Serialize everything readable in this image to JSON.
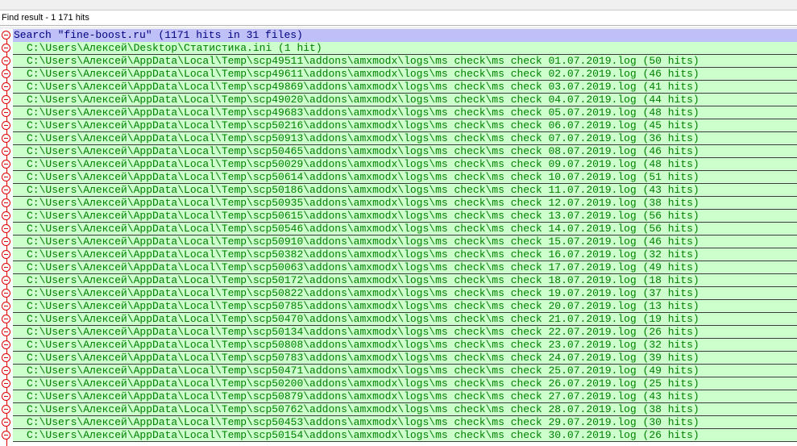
{
  "window": {
    "title": "Find result - 1 171 hits"
  },
  "search": {
    "header": "Search \"fine-boost.ru\" (1171 hits in 31 files)"
  },
  "files": [
    "C:\\Users\\Алексей\\Desktop\\Статистика.ini (1 hit)",
    "C:\\Users\\Алексей\\AppData\\Local\\Temp\\scp49511\\addons\\amxmodx\\logs\\ms check\\ms check 01.07.2019.log (50 hits)",
    "C:\\Users\\Алексей\\AppData\\Local\\Temp\\scp49611\\addons\\amxmodx\\logs\\ms check\\ms check 02.07.2019.log (46 hits)",
    "C:\\Users\\Алексей\\AppData\\Local\\Temp\\scp49869\\addons\\amxmodx\\logs\\ms check\\ms check 03.07.2019.log (41 hits)",
    "C:\\Users\\Алексей\\AppData\\Local\\Temp\\scp49020\\addons\\amxmodx\\logs\\ms check\\ms check 04.07.2019.log (44 hits)",
    "C:\\Users\\Алексей\\AppData\\Local\\Temp\\scp49683\\addons\\amxmodx\\logs\\ms check\\ms check 05.07.2019.log (48 hits)",
    "C:\\Users\\Алексей\\AppData\\Local\\Temp\\scp50216\\addons\\amxmodx\\logs\\ms check\\ms check 06.07.2019.log (45 hits)",
    "C:\\Users\\Алексей\\AppData\\Local\\Temp\\scp50913\\addons\\amxmodx\\logs\\ms check\\ms check 07.07.2019.log (36 hits)",
    "C:\\Users\\Алексей\\AppData\\Local\\Temp\\scp50465\\addons\\amxmodx\\logs\\ms check\\ms check 08.07.2019.log (46 hits)",
    "C:\\Users\\Алексей\\AppData\\Local\\Temp\\scp50029\\addons\\amxmodx\\logs\\ms check\\ms check 09.07.2019.log (48 hits)",
    "C:\\Users\\Алексей\\AppData\\Local\\Temp\\scp50614\\addons\\amxmodx\\logs\\ms check\\ms check 10.07.2019.log (51 hits)",
    "C:\\Users\\Алексей\\AppData\\Local\\Temp\\scp50186\\addons\\amxmodx\\logs\\ms check\\ms check 11.07.2019.log (43 hits)",
    "C:\\Users\\Алексей\\AppData\\Local\\Temp\\scp50935\\addons\\amxmodx\\logs\\ms check\\ms check 12.07.2019.log (38 hits)",
    "C:\\Users\\Алексей\\AppData\\Local\\Temp\\scp50615\\addons\\amxmodx\\logs\\ms check\\ms check 13.07.2019.log (56 hits)",
    "C:\\Users\\Алексей\\AppData\\Local\\Temp\\scp50546\\addons\\amxmodx\\logs\\ms check\\ms check 14.07.2019.log (56 hits)",
    "C:\\Users\\Алексей\\AppData\\Local\\Temp\\scp50910\\addons\\amxmodx\\logs\\ms check\\ms check 15.07.2019.log (46 hits)",
    "C:\\Users\\Алексей\\AppData\\Local\\Temp\\scp50382\\addons\\amxmodx\\logs\\ms check\\ms check 16.07.2019.log (32 hits)",
    "C:\\Users\\Алексей\\AppData\\Local\\Temp\\scp50063\\addons\\amxmodx\\logs\\ms check\\ms check 17.07.2019.log (49 hits)",
    "C:\\Users\\Алексей\\AppData\\Local\\Temp\\scp50172\\addons\\amxmodx\\logs\\ms check\\ms check 18.07.2019.log (18 hits)",
    "C:\\Users\\Алексей\\AppData\\Local\\Temp\\scp50822\\addons\\amxmodx\\logs\\ms check\\ms check 19.07.2019.log (37 hits)",
    "C:\\Users\\Алексей\\AppData\\Local\\Temp\\scp50785\\addons\\amxmodx\\logs\\ms check\\ms check 20.07.2019.log (13 hits)",
    "C:\\Users\\Алексей\\AppData\\Local\\Temp\\scp50470\\addons\\amxmodx\\logs\\ms check\\ms check 21.07.2019.log (19 hits)",
    "C:\\Users\\Алексей\\AppData\\Local\\Temp\\scp50134\\addons\\amxmodx\\logs\\ms check\\ms check 22.07.2019.log (26 hits)",
    "C:\\Users\\Алексей\\AppData\\Local\\Temp\\scp50808\\addons\\amxmodx\\logs\\ms check\\ms check 23.07.2019.log (32 hits)",
    "C:\\Users\\Алексей\\AppData\\Local\\Temp\\scp50783\\addons\\amxmodx\\logs\\ms check\\ms check 24.07.2019.log (39 hits)",
    "C:\\Users\\Алексей\\AppData\\Local\\Temp\\scp50471\\addons\\amxmodx\\logs\\ms check\\ms check 25.07.2019.log (49 hits)",
    "C:\\Users\\Алексей\\AppData\\Local\\Temp\\scp50200\\addons\\amxmodx\\logs\\ms check\\ms check 26.07.2019.log (25 hits)",
    "C:\\Users\\Алексей\\AppData\\Local\\Temp\\scp50879\\addons\\amxmodx\\logs\\ms check\\ms check 27.07.2019.log (43 hits)",
    "C:\\Users\\Алексей\\AppData\\Local\\Temp\\scp50762\\addons\\amxmodx\\logs\\ms check\\ms check 28.07.2019.log (38 hits)",
    "C:\\Users\\Алексей\\AppData\\Local\\Temp\\scp50453\\addons\\amxmodx\\logs\\ms check\\ms check 29.07.2019.log (30 hits)",
    "C:\\Users\\Алексей\\AppData\\Local\\Temp\\scp50154\\addons\\amxmodx\\logs\\ms check\\ms check 30.07.2019.log (26 hits)"
  ],
  "colors": {
    "search_bg": "#c0c0f8",
    "search_text": "#000080",
    "file_bg": "#ccffcc",
    "file_text": "#008000",
    "marker": "#e00000"
  },
  "icons": {
    "fold_marker": "collapse-circle-icon"
  }
}
